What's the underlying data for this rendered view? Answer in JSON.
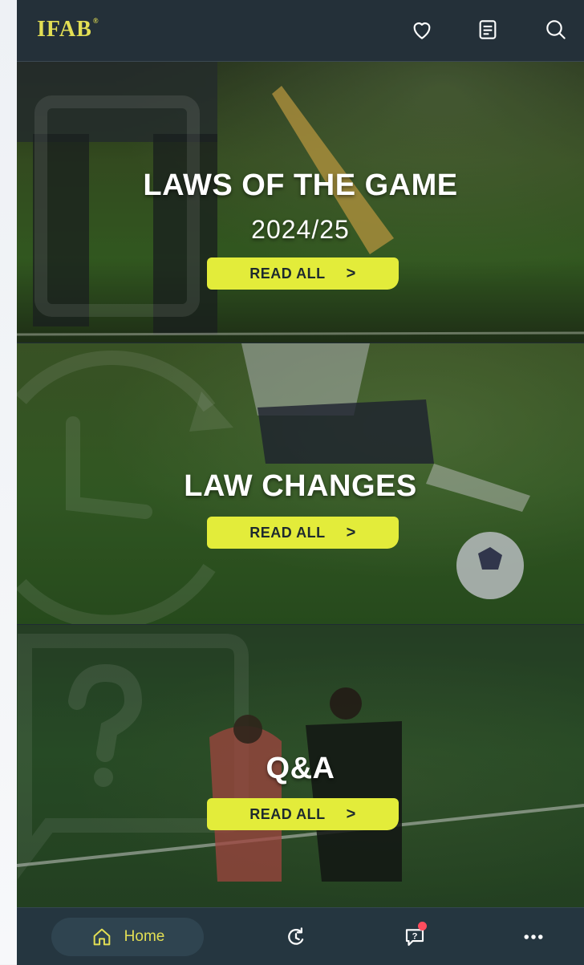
{
  "header": {
    "logo": "IFAB",
    "logo_reg": "®",
    "icons": [
      "heart-icon",
      "document-icon",
      "search-icon"
    ]
  },
  "sections": [
    {
      "title": "LAWS OF THE GAME",
      "subtitle": "2024/25",
      "button": "READ ALL",
      "chevron": ">"
    },
    {
      "title": "LAW CHANGES",
      "button": "READ ALL",
      "chevron": ">"
    },
    {
      "title": "Q&A",
      "button": "READ ALL",
      "chevron": ">"
    }
  ],
  "bottom_nav": {
    "home_label": "Home",
    "items": [
      "home-icon",
      "history-icon",
      "quiz-icon",
      "more-icon"
    ]
  },
  "colors": {
    "accent": "#e3ec3a",
    "logo": "#e3df54",
    "header_bg": "#243039",
    "nav_bg": "#253640",
    "badge": "#ff4d5e"
  }
}
